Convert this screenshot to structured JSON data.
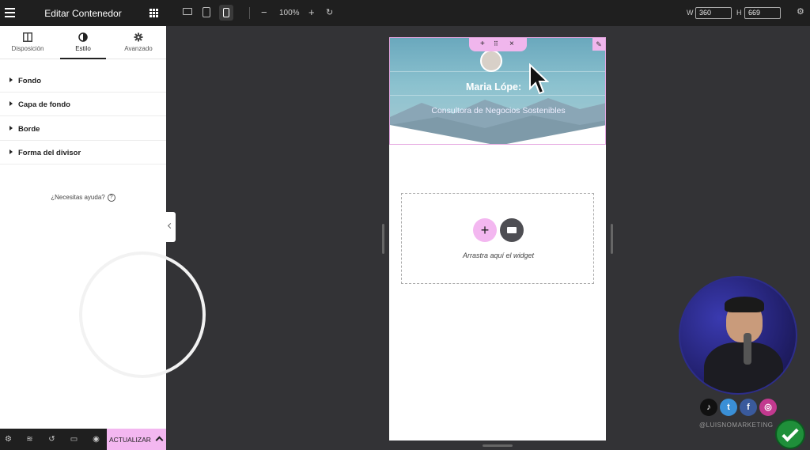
{
  "panel": {
    "title": "Editar Contenedor",
    "tabs": [
      {
        "label": "Disposición",
        "icon": "layout-icon"
      },
      {
        "label": "Estilo",
        "icon": "contrast-icon"
      },
      {
        "label": "Avanzado",
        "icon": "gear-icon"
      }
    ],
    "active_tab": "Estilo",
    "sections": [
      "Fondo",
      "Capa de fondo",
      "Borde",
      "Forma del divisor"
    ],
    "help_text": "¿Necesitas ayuda?",
    "update_label": "ACTUALIZAR"
  },
  "toolbar": {
    "zoom": "100%",
    "width_label": "W",
    "width_value": "360",
    "height_label": "H",
    "height_value": "669"
  },
  "canvas": {
    "hero_name": "Maria Lópe:",
    "hero_subtitle": "Consultora de Negocios Sostenibles",
    "drop_hint": "Arrastra aquí el widget"
  },
  "overlay": {
    "social_handle": "@LUISNOMARKETING"
  },
  "colors": {
    "accent": "#f3b7f0",
    "dark_bar": "#1f1f1f",
    "canvas_bg": "#333336"
  }
}
